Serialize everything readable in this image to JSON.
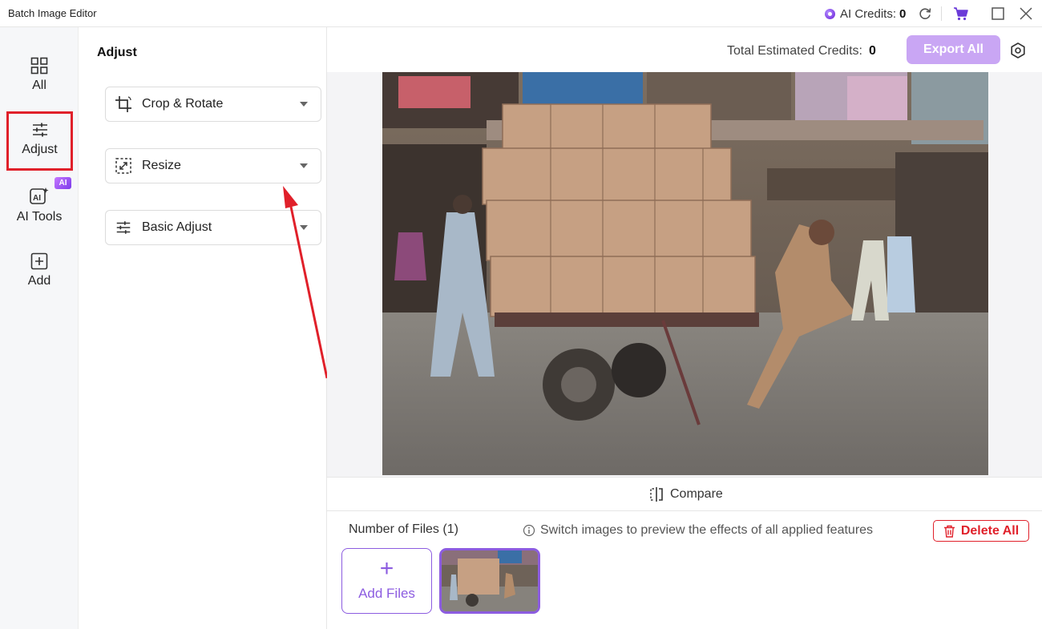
{
  "window": {
    "title": "Batch Image Editor",
    "ai_credits_label": "AI Credits:",
    "ai_credits_value": "0"
  },
  "sidebar": {
    "items": [
      {
        "label": "All",
        "icon": "grid-icon"
      },
      {
        "label": "Adjust",
        "icon": "sliders-icon"
      },
      {
        "label": "AI Tools",
        "icon": "ai-tools-icon",
        "badge": "AI"
      },
      {
        "label": "Add",
        "icon": "plus-square-icon"
      }
    ],
    "selected": "Adjust"
  },
  "panel": {
    "title": "Adjust",
    "options": [
      {
        "label": "Crop & Rotate",
        "icon": "crop-rotate-icon"
      },
      {
        "label": "Resize",
        "icon": "resize-icon"
      },
      {
        "label": "Basic Adjust",
        "icon": "sliders-icon"
      }
    ]
  },
  "header": {
    "estimated_label": "Total Estimated Credits:",
    "estimated_value": "0",
    "export_label": "Export All"
  },
  "preview": {
    "compare_label": "Compare"
  },
  "files": {
    "count_label": "Number of Files (1)",
    "hint": "Switch images to preview the effects of all applied features",
    "delete_label": "Delete All",
    "add_label": "Add Files"
  },
  "colors": {
    "accent": "#8c5ce0",
    "export_bg": "#c9a6f4",
    "highlight_red": "#e0202a"
  }
}
